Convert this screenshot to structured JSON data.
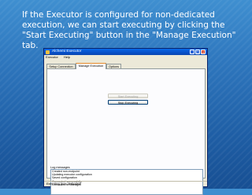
{
  "slide": {
    "caption": "If the Executor is configured for non-dedicated execution, we can start executing by clicking the \"Start Executing\" button in the \"Manage Execution\" tab."
  },
  "window": {
    "title": "Alchemi Executor",
    "menu": [
      "Executor",
      "Help"
    ],
    "tabs": [
      "Setup Connection",
      "Manage Execution",
      "Options"
    ],
    "active_tab": "Manage Execution",
    "start_button": "Start Executing",
    "stop_button": "Stop Executing",
    "log_label": "Log messages",
    "log_lines": [
      "Created non-endpoint",
      "Updating executor configuration",
      "Saved configuration",
      "Connected successfully",
      "Connected to Manager"
    ],
    "status": "Executing (non-dedicated)"
  }
}
